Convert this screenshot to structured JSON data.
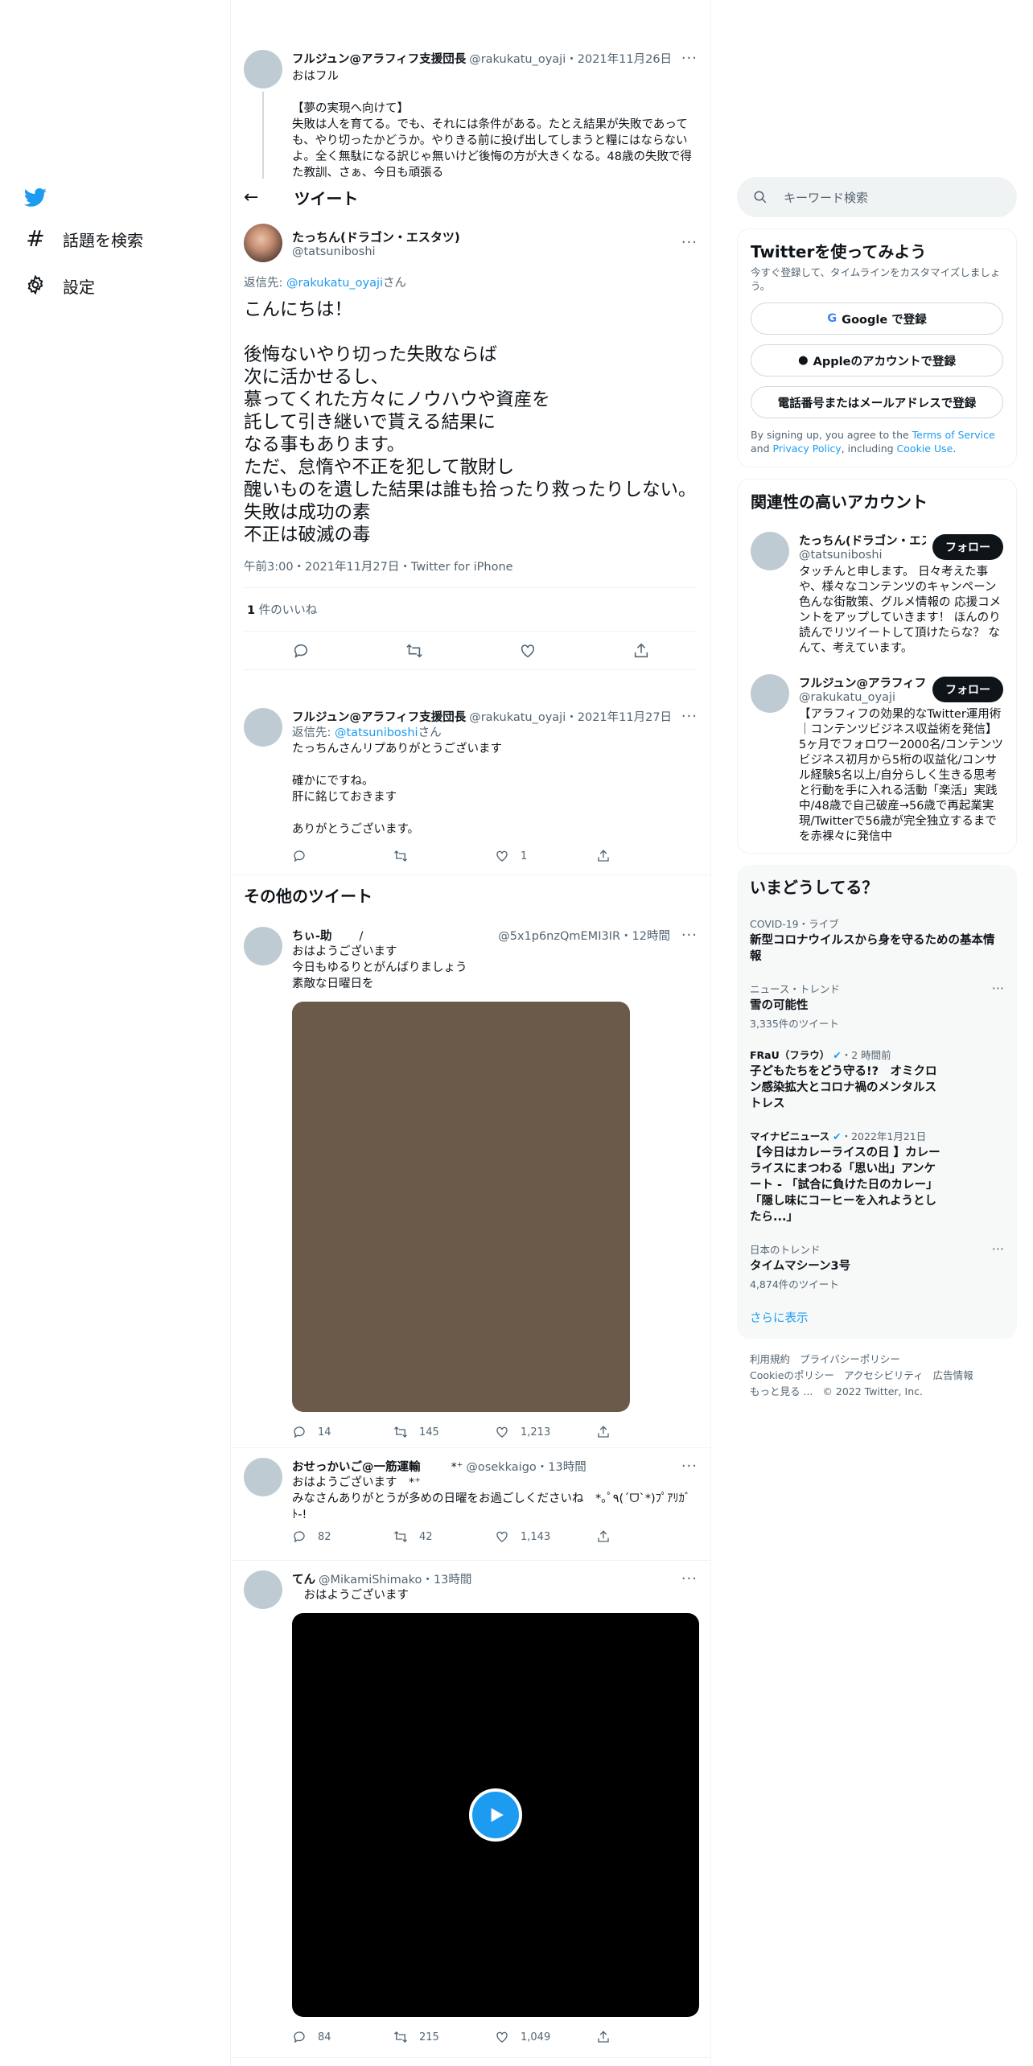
{
  "nav": {
    "explore": "話題を検索",
    "settings": "設定"
  },
  "top_tweet": {
    "name": "フルジュン@アラフィフ支援団長",
    "handle": "@rakukatu_oyaji",
    "date": "・2021年11月26日",
    "lines": [
      "おはフル",
      "",
      "【夢の実現へ向けて】",
      "失敗は人を育てる。でも、それには条件がある。たとえ結果が失敗であっても、やり切ったかどうか。やりきる前に投げ出してしまうと糧にはならないよ。全く無駄になる訳じゃ無いけど後悔の方が大きくなる。48歳の失敗で得た教訓、さぁ、今日も頑張る"
    ]
  },
  "header": {
    "back": "←",
    "title": "ツイート"
  },
  "main": {
    "name": "たっちん(ドラゴン・エスタツ)",
    "handle": "@tatsuniboshi",
    "reply_prefix": "返信先: ",
    "reply_to": "@rakukatu_oyaji",
    "reply_suffix": "さん",
    "lines": [
      "こんにちは！",
      "",
      "後悔ないやり切った失敗ならば",
      "次に活かせるし、",
      "慕ってくれた方々にノウハウや資産を",
      "託して引き継いで貰える結果に",
      "なる事もあります。",
      "ただ、怠惰や不正を犯して散財し",
      "醜いものを遺した結果は誰も拾ったり救ったりしない。",
      "失敗は成功の素",
      "不正は破滅の毒"
    ],
    "meta": "午前3:00・2021年11月27日・Twitter for iPhone",
    "likes_num": "1",
    "likes_label": "件のいいね"
  },
  "reply": {
    "name": "フルジュン@アラフィフ支援団長",
    "handle": "@rakukatu_oyaji",
    "date": "・2021年11月27日",
    "reply_prefix": "返信先: ",
    "reply_to": "@tatsuniboshi",
    "reply_suffix": "さん",
    "lines": [
      "たっちんさんリプありがとうございます",
      "",
      "確かにですね。",
      "肝に銘じておきます",
      "",
      "ありがとうございます。"
    ],
    "like_count": "1"
  },
  "more_title": "その他のツイート",
  "t1": {
    "name": "ちぃ-助",
    "emoji": "/",
    "handle": "@5x1p6nzQmEMI3IR",
    "time": "・12時間",
    "lines": [
      "おはようございます",
      "今日もゆるりとがんばりましょう",
      "素敵な日曜日を"
    ],
    "replies": "14",
    "retweets": "145",
    "likes": "1,213"
  },
  "t2": {
    "name": "おせっかいご@一筋運輸",
    "handle": "@osekkaigo",
    "time": "・13時間",
    "lines": [
      "おはようございます　*⁺",
      "みなさんありがとうが多めの日曜をお過ごしくださいね　*｡ﾟ٩(ˊᗜˋ*)ﾌﾟｱﾘｶﾞﾄ-!"
    ],
    "replies": "82",
    "retweets": "42",
    "likes": "1,143"
  },
  "t3": {
    "name": "てん",
    "handle": "@MikamiShimako",
    "time": "・13時間",
    "lines": [
      "　おはようございます"
    ],
    "replies": "84",
    "retweets": "215",
    "likes": "1,049"
  },
  "search": {
    "placeholder": "キーワード検索"
  },
  "signup": {
    "title": "Twitterを使ってみよう",
    "sub": "今すぐ登録して、タイムラインをカスタマイズしましょう。",
    "google": "Google で登録",
    "apple": "Appleのアカウントで登録",
    "phone": "電話番号またはメールアドレスで登録",
    "terms_a": "By signing up, you agree to the ",
    "terms_b": "Terms of Service",
    "terms_c": " and ",
    "terms_d": "Privacy Policy",
    "terms_e": ", including ",
    "terms_f": "Cookie Use",
    "terms_g": "."
  },
  "related": {
    "title": "関連性の高いアカウント",
    "follow": "フォロー",
    "a1": {
      "name": "たっちん(ドラゴン・エスタツ)",
      "handle": "@tatsuniboshi",
      "bio": "タッチんと申します。 日々考えた事や、様々なコンテンツのキャンペーン色んな街散策、グルメ情報の 応援コメントをアップしていきます！ ほんのり読んでリツイートして頂けたらな？ なんて、考えています。"
    },
    "a2": {
      "name": "フルジュン@アラフィフ支援団長",
      "handle": "@rakukatu_oyaji",
      "bio": "【アラフィフの効果的なTwitter運用術｜コンテンツビジネス収益術を発信】5ヶ月でフォロワー2000名/コンテンツビジネス初月から5桁の収益化/コンサル経験5名以上/自分らしく生きる思考と行動を手に入れる活動「楽活」実践中/48歳で自己破産→56歳で再起業実現/Twitterで56歳が完全独立するまでを赤裸々に発信中"
    }
  },
  "trends": {
    "title": "いまどうしてる？",
    "t1": {
      "ctx": "COVID-19・ライブ",
      "title": "新型コロナウイルスから身を守るための基本情報"
    },
    "t2": {
      "ctx": "ニュース・トレンド",
      "title": "雪の可能性",
      "count": "3,335件のツイート"
    },
    "t3": {
      "src": "FRaU（フラウ）",
      "time": "・2 時間前",
      "title": "子どもたちをどう守る!?　オミクロン感染拡大とコロナ禍のメンタルストレス"
    },
    "t4": {
      "src": "マイナビニュース",
      "time": "・2022年1月21日",
      "title": "【今日はカレーライスの日 】カレーライスにまつわる「思い出」アンケート - 「試合に負けた日のカレー」「隠し味にコーヒーを入れようとしたら...」"
    },
    "t5": {
      "ctx": "日本のトレンド",
      "title": "タイムマシーン3号",
      "count": "4,874件のツイート"
    },
    "show_more": "さらに表示"
  },
  "footer": {
    "l1": "利用規約",
    "l2": "プライバシーポリシー",
    "l3": "Cookieのポリシー",
    "l4": "アクセシビリティ",
    "l5": "広告情報",
    "l6": "もっと見る ...",
    "l7": "© 2022 Twitter, Inc."
  },
  "colors": {
    "accent": "#1d9bf0",
    "text": "#0f1419",
    "muted": "#536471",
    "photo": "#6b5a4a"
  }
}
